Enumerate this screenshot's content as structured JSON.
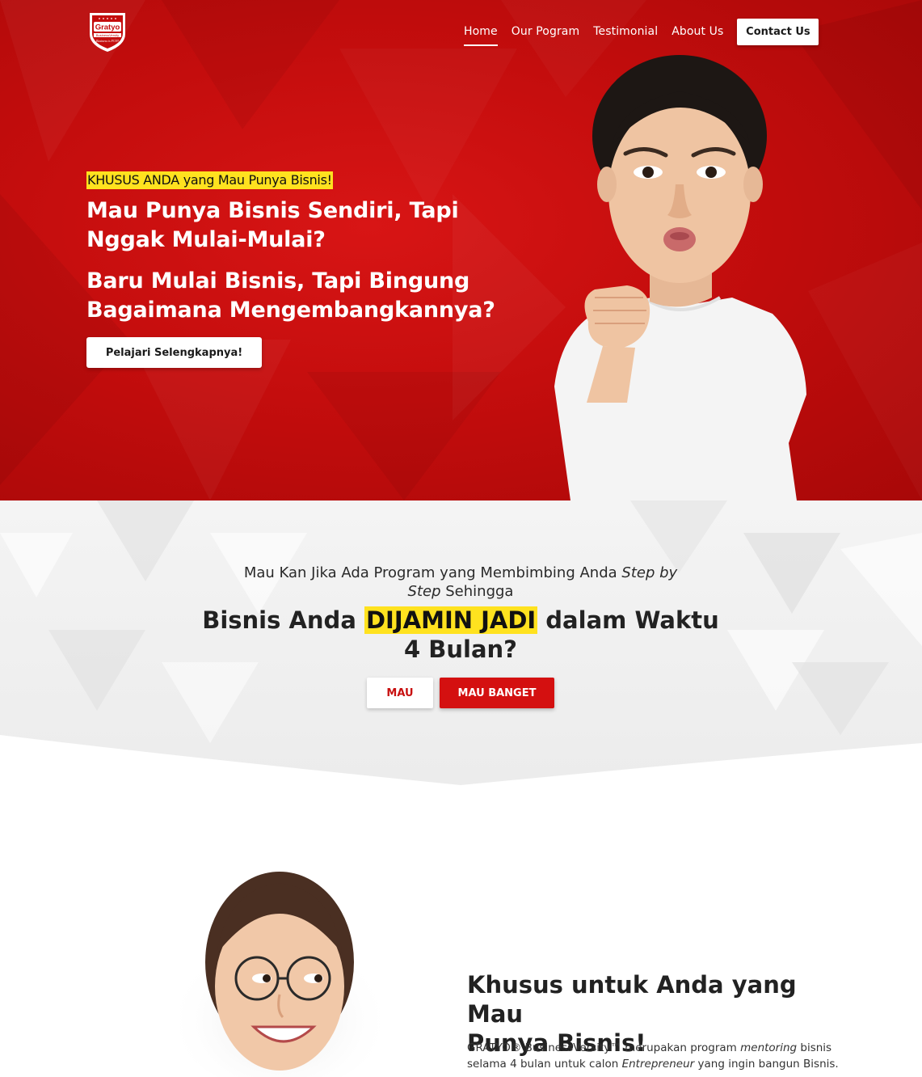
{
  "brand": {
    "logo_text": "Gratyo",
    "logo_sub": "BusinessVersity",
    "logo_tagline": "Business is FUN!"
  },
  "nav": {
    "items": [
      {
        "label": "Home",
        "active": true
      },
      {
        "label": "Our Pogram",
        "active": false
      },
      {
        "label": "Testimonial",
        "active": false
      },
      {
        "label": "About Us",
        "active": false
      }
    ],
    "cta": "Contact Us"
  },
  "hero": {
    "eyebrow": "KHUSUS ANDA yang Mau Punya Bisnis!",
    "headline_1_line1": "Mau Punya Bisnis Sendiri, Tapi",
    "headline_1_line2": "Nggak Mulai-Mulai?",
    "headline_2_line1": "Baru Mulai Bisnis, Tapi Bingung",
    "headline_2_line2": "Bagaimana Mengembangkannya?",
    "button": "Pelajari Selengkapnya!"
  },
  "offer": {
    "intro_part1": "Mau Kan Jika Ada Program yang Membimbing Anda ",
    "intro_em1": "Step by",
    "intro_em2": "Step",
    "intro_part2": " Sehingga",
    "headline_before": "Bisnis Anda ",
    "headline_highlight": "DIJAMIN JADI",
    "headline_after": " dalam Waktu",
    "headline_line2": "4 Bulan?",
    "button_yes": "MAU",
    "button_yes_strong": "MAU BANGET"
  },
  "about": {
    "title_line1": "Khusus untuk Anda yang Mau",
    "title_line2": "Punya Bisnis!",
    "body_part1": "GRATYO® BusinessVersity™ merupakan program ",
    "body_em1": "mentoring",
    "body_part2": " bisnis",
    "body_part3": "selama 4 bulan untuk calon ",
    "body_em2": "Entrepreneur",
    "body_part4": " yang ingin bangun Bisnis."
  },
  "colors": {
    "brand_red": "#c40d0d",
    "highlight_yellow": "#ffe21f",
    "button_red": "#d41010"
  }
}
